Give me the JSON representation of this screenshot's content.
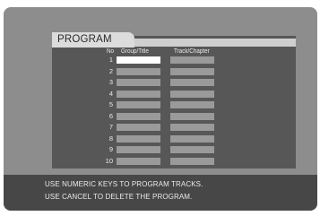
{
  "screen": {
    "title": "PROGRAM",
    "columns": {
      "no": "No",
      "group": "Group/Title",
      "track": "Track/Chapter"
    },
    "rows": [
      {
        "no": "1"
      },
      {
        "no": "2"
      },
      {
        "no": "3"
      },
      {
        "no": "4"
      },
      {
        "no": "5"
      },
      {
        "no": "6"
      },
      {
        "no": "7"
      },
      {
        "no": "8"
      },
      {
        "no": "9"
      },
      {
        "no": "10"
      }
    ],
    "selected_row": 1
  },
  "footer": {
    "line1": "USE NUMERIC KEYS TO PROGRAM TRACKS.",
    "line2": "USE CANCEL TO DELETE THE PROGRAM."
  }
}
